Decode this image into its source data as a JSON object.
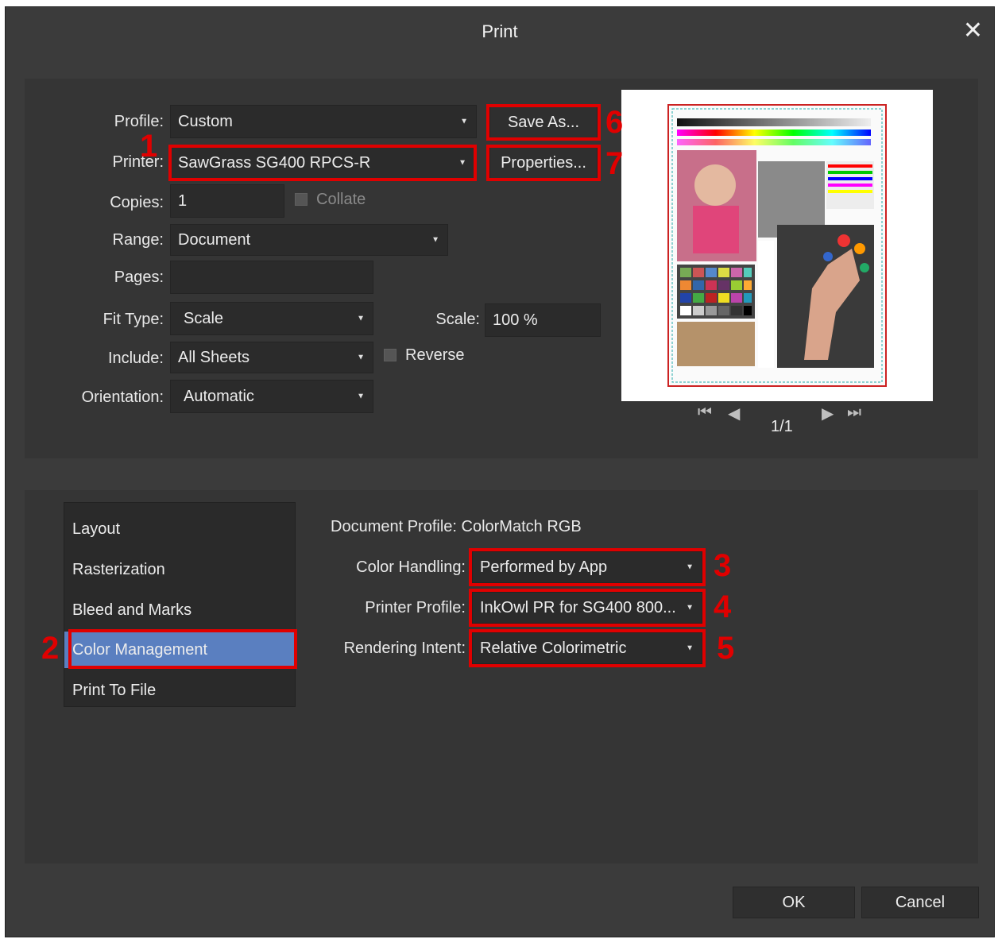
{
  "dialog": {
    "title": "Print"
  },
  "form": {
    "profile": {
      "label": "Profile:",
      "value": "Custom"
    },
    "printer": {
      "label": "Printer:",
      "value": "SawGrass SG400 RPCS-R"
    },
    "copies": {
      "label": "Copies:",
      "value": "1"
    },
    "collate": {
      "label": "Collate",
      "checked": false
    },
    "range": {
      "label": "Range:",
      "value": "Document"
    },
    "pages": {
      "label": "Pages:",
      "value": ""
    },
    "fit_type": {
      "label": "Fit Type:",
      "value": "Scale"
    },
    "scale": {
      "label": "Scale:",
      "value": "100 %"
    },
    "include": {
      "label": "Include:",
      "value": "All Sheets"
    },
    "reverse": {
      "label": "Reverse",
      "checked": false
    },
    "orientation": {
      "label": "Orientation:",
      "value": "Automatic"
    }
  },
  "buttons": {
    "save_as": "Save As...",
    "properties": "Properties...",
    "ok": "OK",
    "cancel": "Cancel"
  },
  "preview": {
    "page_indicator": "1/1"
  },
  "sidebar": {
    "items": [
      {
        "label": "Layout"
      },
      {
        "label": "Rasterization"
      },
      {
        "label": "Bleed and Marks"
      },
      {
        "label": "Color Management",
        "active": true
      },
      {
        "label": "Print To File"
      }
    ]
  },
  "color": {
    "document_profile": "Document Profile: ColorMatch RGB",
    "handling": {
      "label": "Color Handling:",
      "value": "Performed by App"
    },
    "printer_profile": {
      "label": "Printer Profile:",
      "value": "InkOwl PR for SG400 800..."
    },
    "rendering_intent": {
      "label": "Rendering Intent:",
      "value": "Relative Colorimetric"
    }
  },
  "annotations": [
    "1",
    "2",
    "3",
    "4",
    "5",
    "6",
    "7"
  ],
  "colors": {
    "highlight": "#e00000",
    "active_item": "#5a7fc0",
    "dialog_bg": "#3b3b3b"
  }
}
